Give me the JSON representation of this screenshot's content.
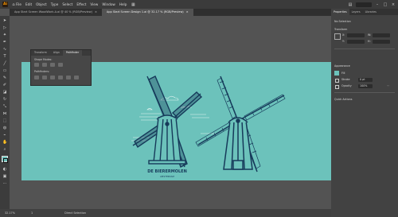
{
  "menubar": {
    "logo": "Ai",
    "items": [
      "File",
      "Edit",
      "Object",
      "Type",
      "Select",
      "Effect",
      "View",
      "Window",
      "Help"
    ]
  },
  "tabs": [
    {
      "label": "App Start Screen WoodWork-A.ai @ 40 % (RGB/Preview)",
      "active": false
    },
    {
      "label": "App Start Screen Design 1.ai @ 32.17 % (RGB/Preview)",
      "active": true
    }
  ],
  "float_panel": {
    "tabs": [
      "Transform",
      "Align",
      "Pathfinder"
    ],
    "shape_modes_label": "Shape Modes:",
    "pathfinders_label": "Pathfinders:"
  },
  "artwork": {
    "title": "DE BIERERMOLEN",
    "subtitle": "AMSTERDAM"
  },
  "properties": {
    "tabs": [
      "Properties",
      "Layers",
      "Libraries"
    ],
    "selection": "No Selection",
    "transform_label": "Transform",
    "x_label": "X:",
    "y_label": "Y:",
    "w_label": "W:",
    "h_label": "H:",
    "appearance_label": "Appearance",
    "fill_label": "Fill",
    "stroke_label": "Stroke",
    "stroke_value": "0 pt",
    "opacity_label": "Opacity",
    "opacity_value": "100%",
    "quick_actions_label": "Quick Actions"
  },
  "status": {
    "zoom": "32.17%",
    "page": "1",
    "tool": "Direct Selection"
  },
  "colors": {
    "artboard": "#6cc2bb",
    "art_dark": "#163a5a",
    "fill_swatch": "#6cc2bb"
  }
}
